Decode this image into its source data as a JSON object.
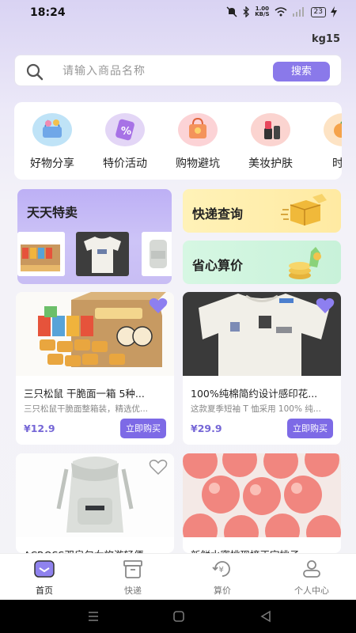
{
  "status_bar": {
    "time": "18:24",
    "net_speed_value": "1.00",
    "net_speed_unit": "KB/S",
    "battery": "23"
  },
  "user": {
    "name": "kg15"
  },
  "search": {
    "placeholder": "请输入商品名称",
    "button_label": "搜索"
  },
  "categories": [
    {
      "label": "好物分享",
      "icon": "shopping-basket-icon",
      "color": "#bfe3f7"
    },
    {
      "label": "特价活动",
      "icon": "discount-tag-icon",
      "color": "#e3d6f6"
    },
    {
      "label": "购物避坑",
      "icon": "shopping-bag-icon",
      "color": "#fcd3d6"
    },
    {
      "label": "美妆护肤",
      "icon": "lipstick-icon",
      "color": "#fbd4d0"
    },
    {
      "label": "时鲜",
      "icon": "produce-icon",
      "color": "#fde3c4"
    }
  ],
  "promos": {
    "daily": {
      "title": "天天特卖"
    },
    "express": {
      "title": "快递查询"
    },
    "save": {
      "title": "省心算价"
    }
  },
  "products": [
    {
      "title": "三只松鼠 干脆面一箱 5种...",
      "desc": "三只松鼠干脆面整箱装，精选优...",
      "price": "¥12.9",
      "buy_label": "立即购买",
      "favorited": true,
      "image": "snack-box-image"
    },
    {
      "title": "100%纯棉简约设计感印花...",
      "desc": "这款夏季短袖 T 恤采用 100% 纯...",
      "price": "¥29.9",
      "buy_label": "立即购买",
      "favorited": true,
      "image": "white-tshirt-image"
    },
    {
      "title": "ACROSS双肩包女旅游轻便...",
      "image": "backpack-image",
      "favorited": false
    },
    {
      "title": "新鲜水蜜桃现摘正宗桃子...",
      "image": "peaches-image",
      "favorited": false
    }
  ],
  "tabs": [
    {
      "label": "首页",
      "icon": "home-icon",
      "active": true
    },
    {
      "label": "快递",
      "icon": "package-box-icon",
      "active": false
    },
    {
      "label": "算价",
      "icon": "price-calc-icon",
      "active": false
    },
    {
      "label": "个人中心",
      "icon": "user-profile-icon",
      "active": false
    }
  ],
  "colors": {
    "accent": "#8a79ea",
    "price": "#7566d6",
    "background": "#f3f3f7"
  }
}
